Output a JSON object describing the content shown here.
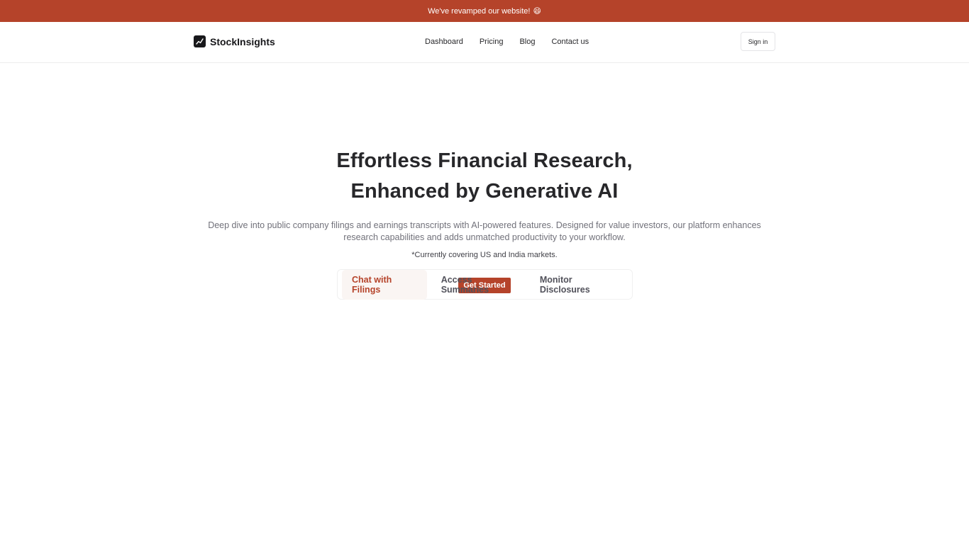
{
  "announcement": {
    "text": "We've revamped our website!",
    "emoji": "😄"
  },
  "brand": {
    "name": "StockInsights",
    "icon": "trend-chart-icon"
  },
  "nav": {
    "links": [
      {
        "label": "Dashboard"
      },
      {
        "label": "Pricing"
      },
      {
        "label": "Blog"
      },
      {
        "label": "Contact us"
      }
    ],
    "signin_label": "Sign in"
  },
  "hero": {
    "title_line1": "Effortless Financial Research,",
    "title_line2": "Enhanced by Generative AI",
    "description": "Deep dive into public company filings and earnings transcripts with AI-powered features. Designed for value investors, our platform enhances research capabilities and adds unmatched productivity to your workflow.",
    "note": "*Currently covering US and India markets.",
    "cta_label": "Get Started"
  },
  "tabs": [
    {
      "label": "Chat with Filings",
      "active": true
    },
    {
      "label": "Access Summaries",
      "active": false
    },
    {
      "label": "Monitor Disclosures",
      "active": false
    }
  ],
  "colors": {
    "accent": "#b5432a",
    "text": "#27272a",
    "muted": "#71717a"
  }
}
